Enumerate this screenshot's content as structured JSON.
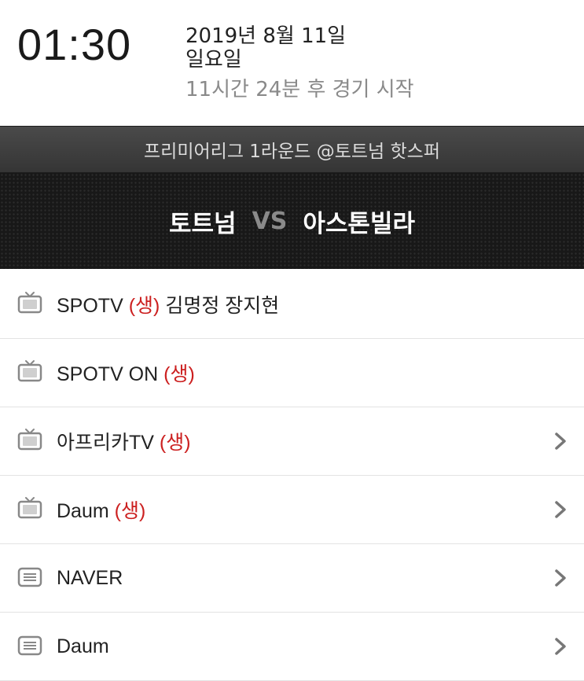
{
  "header": {
    "time": "01:30",
    "date": "2019년 8월 11일",
    "weekday": "일요일",
    "countdown": "11시간 24분 후 경기 시작"
  },
  "league": {
    "title": "프리미어리그 1라운드 @토트넘 핫스퍼"
  },
  "match": {
    "home": "토트넘",
    "vs": "VS",
    "away": "아스톤빌라"
  },
  "broadcasts": [
    {
      "name": "SPOTV",
      "live": "(생)",
      "extra": "김명정 장지현",
      "icon": "tv-icon",
      "has_arrow": false
    },
    {
      "name": "SPOTV ON",
      "live": "(생)",
      "extra": "",
      "icon": "tv-icon",
      "has_arrow": false
    },
    {
      "name": "아프리카TV",
      "live": "(생)",
      "extra": "",
      "icon": "tv-icon",
      "has_arrow": true
    },
    {
      "name": "Daum",
      "live": "(생)",
      "extra": "",
      "icon": "tv-icon",
      "has_arrow": true
    },
    {
      "name": "NAVER",
      "live": "",
      "extra": "",
      "icon": "text-icon",
      "has_arrow": true
    },
    {
      "name": "Daum",
      "live": "",
      "extra": "",
      "icon": "text-icon",
      "has_arrow": true
    }
  ],
  "colors": {
    "live_red": "#cc2020",
    "vs_gray": "#8a8a8a"
  }
}
